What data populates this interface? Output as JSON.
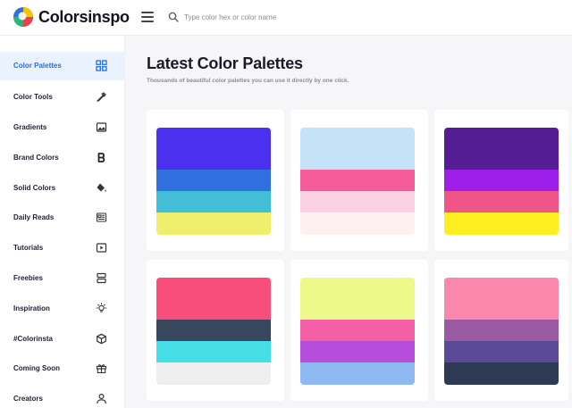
{
  "header": {
    "brand": "Colorsinspo",
    "search_placeholder": "Type color hex or color name"
  },
  "sidebar": {
    "items": [
      {
        "label": "Color Palettes",
        "icon": "grid-icon",
        "active": true
      },
      {
        "label": "Color Tools",
        "icon": "eyedropper-icon",
        "active": false
      },
      {
        "label": "Gradients",
        "icon": "image-icon",
        "active": false
      },
      {
        "label": "Brand Colors",
        "icon": "bold-b-icon",
        "active": false
      },
      {
        "label": "Solid Colors",
        "icon": "paint-bucket-icon",
        "active": false
      },
      {
        "label": "Daily Reads",
        "icon": "newspaper-icon",
        "active": false
      },
      {
        "label": "Tutorials",
        "icon": "play-icon",
        "active": false
      },
      {
        "label": "Freebies",
        "icon": "layers-icon",
        "active": false
      },
      {
        "label": "Inspiration",
        "icon": "lightbulb-icon",
        "active": false
      },
      {
        "label": "#Colorinsta",
        "icon": "cube-icon",
        "active": false
      },
      {
        "label": "Coming Soon",
        "icon": "gift-icon",
        "active": false
      },
      {
        "label": "Creators",
        "icon": "user-icon",
        "active": false
      }
    ]
  },
  "main": {
    "title": "Latest Color Palettes",
    "subtitle": "Thousands of beautiful color palettes you can use it directly by one click."
  },
  "palettes": [
    {
      "colors": [
        "#4b30f0",
        "#2f6fde",
        "#43bed8",
        "#f0ee6c"
      ]
    },
    {
      "colors": [
        "#c5e3f6",
        "#f75c9a",
        "#fcd2e2",
        "#fdf0f0"
      ]
    },
    {
      "colors": [
        "#541d93",
        "#9d1fe8",
        "#f05587",
        "#fdee22"
      ]
    },
    {
      "colors": [
        "#f94e7c",
        "#37475e",
        "#45dde6",
        "#efefef"
      ]
    },
    {
      "colors": [
        "#eff98b",
        "#f55fa6",
        "#b74ddb",
        "#8eb9f1"
      ]
    },
    {
      "colors": [
        "#fb87ad",
        "#9a5aa1",
        "#5a4996",
        "#2d3a55"
      ]
    }
  ],
  "colors": {
    "accent": "#2a6fdc",
    "active_bg": "#eaf2fd"
  }
}
